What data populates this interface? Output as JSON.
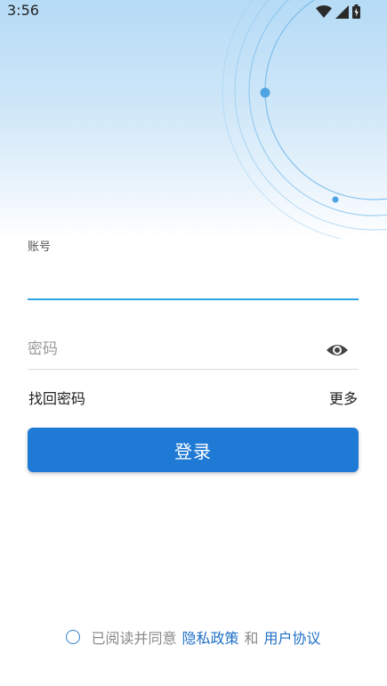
{
  "status_bar": {
    "time": "3:56",
    "icons": [
      "wifi-icon",
      "cellular-signal-icon",
      "battery-icon"
    ]
  },
  "login_form": {
    "account_label": "账号",
    "account_value": "",
    "password_placeholder": "密码",
    "password_value": "",
    "visibility_icon": "eye-icon",
    "find_password_label": "找回密码",
    "more_label": "更多",
    "login_button_label": "登录"
  },
  "agreement": {
    "checked": false,
    "prefix": "已阅读并同意",
    "privacy_policy_label": "隐私政策",
    "conjunction": "和",
    "user_agreement_label": "用户协议"
  },
  "colors": {
    "accent": "#1f7ad6",
    "input_focus_underline": "#2fa4e7",
    "link": "#1f6fc6",
    "hero_top": "#b5dbf6"
  }
}
